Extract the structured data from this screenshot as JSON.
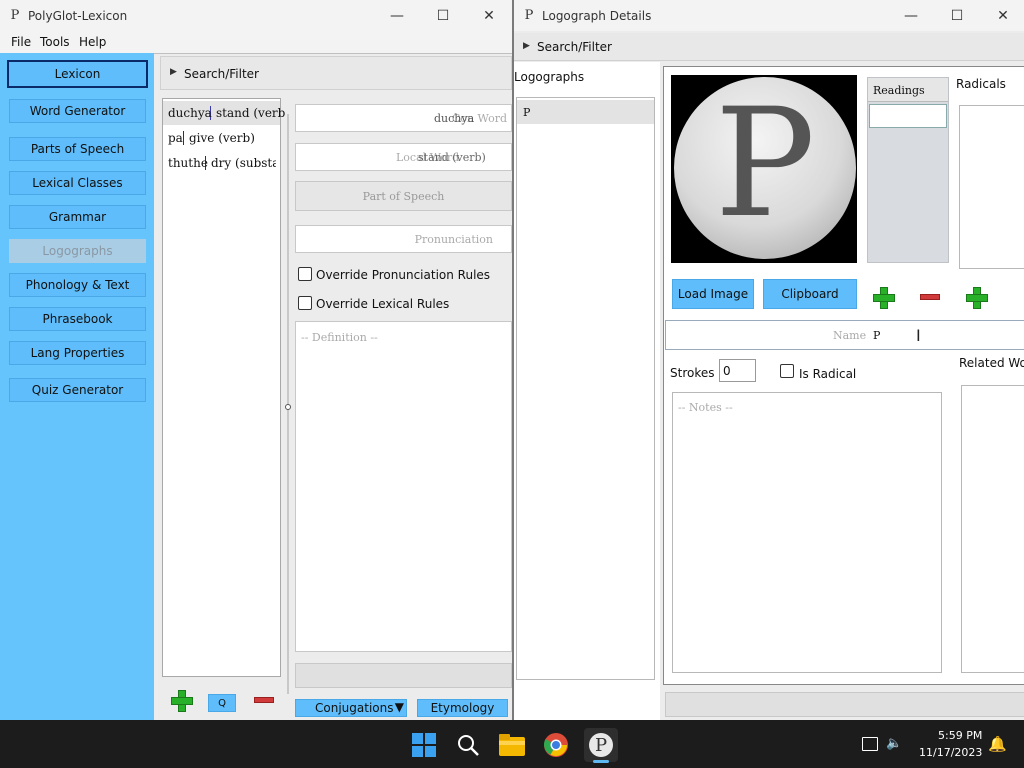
{
  "left_window": {
    "title": "PolyGlot-Lexicon",
    "menu": [
      "File",
      "Tools",
      "Help"
    ],
    "sidebar": {
      "items": [
        {
          "label": "Lexicon"
        },
        {
          "label": "Word Generator"
        },
        {
          "label": "Parts of Speech"
        },
        {
          "label": "Lexical Classes"
        },
        {
          "label": "Grammar"
        },
        {
          "label": "Logographs"
        },
        {
          "label": "Phonology & Text"
        },
        {
          "label": "Phrasebook"
        },
        {
          "label": "Lang Properties"
        },
        {
          "label": "Quiz Generator"
        }
      ]
    },
    "search_filter": "Search/Filter",
    "words": [
      {
        "conword": "duchya",
        "local": "stand (verb"
      },
      {
        "conword": "pa",
        "local": "give (verb)"
      },
      {
        "conword": "thuthe",
        "local": "dry (substar"
      }
    ],
    "fields": {
      "conword_hint": "Con Word",
      "conword_value": "duchya",
      "local_hint": "Local Word",
      "local_value": "stand (verb)",
      "part_of_speech": "Part of Speech",
      "pronunciation": "Pronunciation",
      "override_pron": "Override Pronunciation Rules",
      "override_lex": "Override Lexical Rules",
      "definition": "-- Definition --"
    },
    "bottom": {
      "q_label": "Q",
      "conjugations": "Conjugations",
      "etymology": "Etymology"
    }
  },
  "right_window": {
    "title": "Logograph Details",
    "search_filter": "Search/Filter",
    "logographs_label": "Logographs",
    "logograph_items": [
      "P"
    ],
    "readings_header": "Readings",
    "radicals_label": "Radicals",
    "load_image": "Load Image",
    "clipboard": "Clipboard",
    "name_hint": "Name",
    "name_value": "P",
    "strokes_label": "Strokes",
    "strokes_value": "0",
    "is_radical": "Is Radical",
    "related_words": "Related Wo",
    "notes": "-- Notes --"
  },
  "taskbar": {
    "time": "5:59 PM",
    "date": "11/17/2023"
  }
}
